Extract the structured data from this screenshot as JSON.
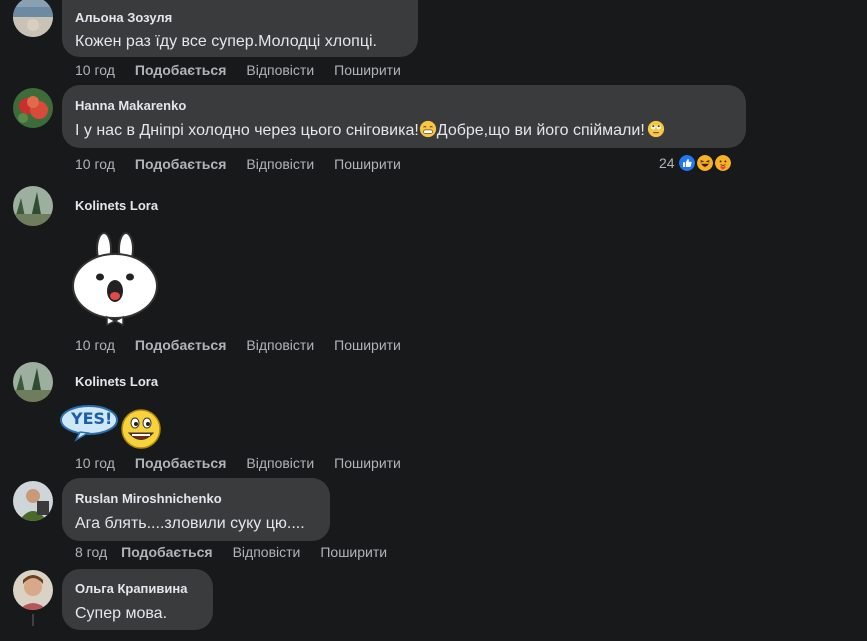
{
  "comments": [
    {
      "author": "Альона Зозуля",
      "text": "Кожен раз їду все супер.Молодці хлопці.",
      "time": "10 год",
      "like": "Подобається",
      "reply": "Відповісти",
      "share": "Поширити"
    },
    {
      "author": "Hanna Makarenko",
      "text_part1": "І у нас в Дніпрі холодно через цього сніговика!",
      "text_part2": "Добре,що ви його спіймали!",
      "time": "10 год",
      "like": "Подобається",
      "reply": "Відповісти",
      "share": "Поширити",
      "reaction_count": "24",
      "reactions": [
        "like-icon",
        "haha-icon",
        "care-icon"
      ]
    },
    {
      "author": "Kolinets Lora",
      "sticker": "bunny-sticker",
      "time": "10 год",
      "like": "Подобається",
      "reply": "Відповісти",
      "share": "Поширити"
    },
    {
      "author": "Kolinets Lora",
      "sticker": "yes-smiley-sticker",
      "sticker_text": "YES!",
      "time": "10 год",
      "like": "Подобається",
      "reply": "Відповісти",
      "share": "Поширити"
    },
    {
      "author": "Ruslan Miroshnichenko",
      "text": "Ага блять....зловили суку цю....",
      "time": "8 год",
      "like": "Подобається",
      "reply": "Відповісти",
      "share": "Поширити"
    },
    {
      "author": "Ольга Крапивина",
      "text": "Супер мова."
    }
  ],
  "colors": {
    "background": "#18191a",
    "bubble": "#3a3b3c",
    "text_primary": "#e4e6eb",
    "text_secondary": "#b0b3b8",
    "like_blue": "#2078f4"
  }
}
